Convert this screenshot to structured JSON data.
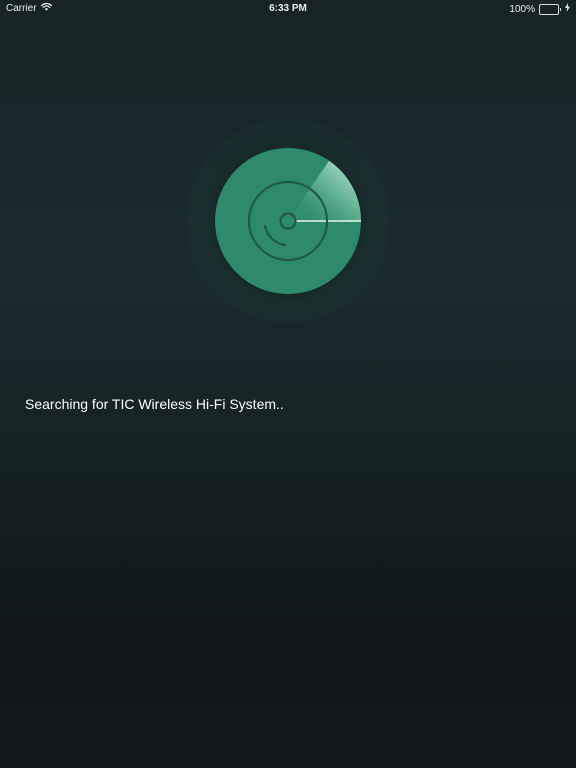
{
  "status_bar": {
    "carrier": "Carrier",
    "time": "6:33 PM",
    "battery_percent": "100%",
    "battery_level": 1.0,
    "wifi_icon": "wifi-icon",
    "battery_icon": "battery-icon",
    "charging_icon": "charging-bolt-icon"
  },
  "scanner": {
    "icon": "disc-radar-icon",
    "disc_color": "#2f8a6c",
    "sweep_color": "#bfe8d8"
  },
  "message": {
    "text": "Searching for TIC Wireless Hi-Fi System.."
  }
}
